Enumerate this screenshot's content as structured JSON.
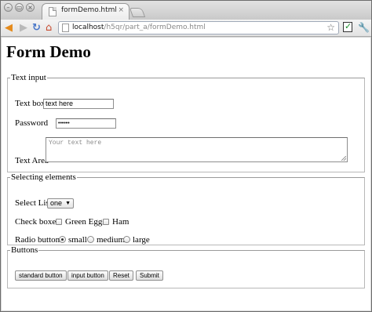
{
  "browser": {
    "tab_title": "formDemo.html",
    "tab_close": "×",
    "url_host": "localhost",
    "url_path": "/h5qr/part_a/formDemo.html",
    "window_controls": [
      "–",
      "▭",
      "×"
    ]
  },
  "icons": {
    "back": "arrow-left-icon",
    "forward": "arrow-right-icon",
    "reload": "reload-icon",
    "home": "home-icon",
    "star": "star-icon",
    "extension": "extension-check-icon",
    "wrench": "wrench-icon"
  },
  "page": {
    "heading": "Form Demo",
    "text_input": {
      "legend": "Text input",
      "textbox_label": "Text box",
      "textbox_value": "text here",
      "password_label": "Password",
      "password_value": "••••••",
      "textarea_label": "Text Area",
      "textarea_placeholder": "Your text here"
    },
    "selecting": {
      "legend": "Selecting elements",
      "select_label": "Select List",
      "select_value": "one",
      "checkbox_label": "Check boxes",
      "checkboxes": [
        {
          "label": "Green Eggs",
          "checked": false
        },
        {
          "label": "Ham",
          "checked": false
        }
      ],
      "radio_label": "Radio buttons",
      "radios": [
        {
          "label": "small",
          "checked": true
        },
        {
          "label": "medium",
          "checked": false
        },
        {
          "label": "large",
          "checked": false
        }
      ]
    },
    "buttons": {
      "legend": "Buttons",
      "items": [
        "standard button",
        "input button",
        "Reset",
        "Submit"
      ]
    }
  }
}
